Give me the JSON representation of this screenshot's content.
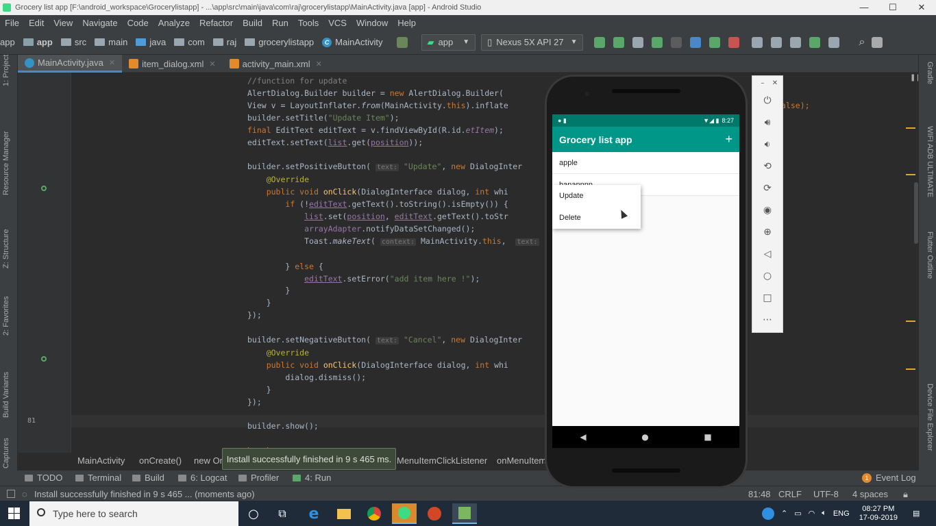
{
  "window": {
    "title": "Grocery list app [F:\\android_workspace\\Grocerylistapp] - ...\\app\\src\\main\\java\\com\\raj\\grocerylistapp\\MainActivity.java [app] - Android Studio",
    "min": "—",
    "max": "☐",
    "close": "✕"
  },
  "menu": [
    "File",
    "Edit",
    "View",
    "Navigate",
    "Code",
    "Analyze",
    "Refactor",
    "Build",
    "Run",
    "Tools",
    "VCS",
    "Window",
    "Help"
  ],
  "nav": {
    "crumbs": [
      "app",
      "src",
      "main",
      "java",
      "com",
      "raj",
      "grocerylistapp",
      "MainActivity"
    ],
    "run_config": "app",
    "device": "Nexus 5X API 27",
    "prefix": "app"
  },
  "left_tools": [
    "1: Project",
    "Resource Manager",
    "Z: Structure",
    "2: Favorites",
    "Build Variants",
    "Captures"
  ],
  "right_tools": [
    "Gradle",
    "WIFI ADB ULTIMATE",
    "Flutter Outline",
    "Device File Explorer"
  ],
  "tabs": [
    {
      "label": "MainActivity.java",
      "color": "#3592c4"
    },
    {
      "label": "item_dialog.xml",
      "color": "#e38b2c"
    },
    {
      "label": "activity_main.xml",
      "color": "#e38b2c"
    }
  ],
  "gutter": {
    "visible_line": "81"
  },
  "code": {
    "hint_context": "context:",
    "hint_text": "text:",
    "hint_text2": "text:",
    "tail1": "alse);"
  },
  "crumbs_bar": {
    "c1": "MainActivity",
    "c2": "onCreate()",
    "c3": "new Or",
    "c4": "MenuItemClickListener",
    "c5": "onMenuItem"
  },
  "balloon": "Install successfully finished in 9 s 465 ms.",
  "bottom_tools": [
    "TODO",
    "Terminal",
    "Build",
    "6: Logcat",
    "Profiler",
    "4: Run"
  ],
  "event_log": "Event Log",
  "event_count": "1",
  "status": {
    "message": "Install successfully finished in 9 s 465 ... (moments ago)",
    "position": "81:48",
    "line_sep": "CRLF",
    "encoding": "UTF-8",
    "indent": "4 spaces"
  },
  "phone": {
    "time": "8:27",
    "app_title": "Grocery list app",
    "add": "+",
    "items": [
      "apple",
      "banannnn"
    ],
    "menu": [
      "Update",
      "Delete"
    ]
  },
  "taskbar": {
    "search_placeholder": "Type here to search",
    "lang": "ENG",
    "time": "08:27 PM",
    "date": "17-09-2019"
  }
}
